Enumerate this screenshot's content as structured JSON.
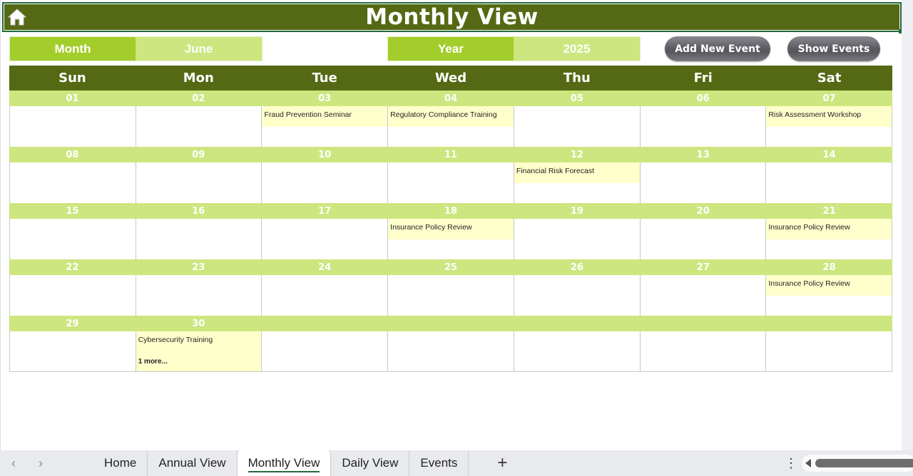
{
  "title": "Monthly View",
  "icons": {
    "home": "home-icon"
  },
  "selectors": {
    "month_label": "Month",
    "month_value": "June",
    "year_label": "Year",
    "year_value": "2025"
  },
  "buttons": {
    "add_event": "Add New Event",
    "show_events": "Show Events"
  },
  "colors": {
    "header_dark": "#556914",
    "label_green": "#a3cd2a",
    "light_green": "#cde67f",
    "event_yellow": "#ffffcc"
  },
  "weekdays": [
    "Sun",
    "Mon",
    "Tue",
    "Wed",
    "Thu",
    "Fri",
    "Sat"
  ],
  "weeks": [
    [
      {
        "d": "01"
      },
      {
        "d": "02"
      },
      {
        "d": "03",
        "event": "Fraud Prevention Seminar"
      },
      {
        "d": "04",
        "event": "Regulatory Compliance Training"
      },
      {
        "d": "05"
      },
      {
        "d": "06"
      },
      {
        "d": "07",
        "event": "Risk Assessment Workshop"
      }
    ],
    [
      {
        "d": "08"
      },
      {
        "d": "09"
      },
      {
        "d": "10"
      },
      {
        "d": "11"
      },
      {
        "d": "12",
        "event": "Financial Risk Forecast"
      },
      {
        "d": "13"
      },
      {
        "d": "14"
      }
    ],
    [
      {
        "d": "15"
      },
      {
        "d": "16"
      },
      {
        "d": "17"
      },
      {
        "d": "18",
        "event": "Insurance Policy Review"
      },
      {
        "d": "19"
      },
      {
        "d": "20"
      },
      {
        "d": "21",
        "event": "Insurance Policy Review"
      }
    ],
    [
      {
        "d": "22"
      },
      {
        "d": "23"
      },
      {
        "d": "24"
      },
      {
        "d": "25"
      },
      {
        "d": "26"
      },
      {
        "d": "27"
      },
      {
        "d": "28",
        "event": "Insurance Policy Review"
      }
    ],
    [
      {
        "d": "29"
      },
      {
        "d": "30",
        "event": "Cybersecurity Training",
        "more": "1 more..."
      },
      {
        "d": ""
      },
      {
        "d": ""
      },
      {
        "d": ""
      },
      {
        "d": ""
      },
      {
        "d": ""
      }
    ]
  ],
  "sheet_tabs": [
    "Home",
    "Annual View",
    "Monthly View",
    "Daily View",
    "Events"
  ],
  "active_tab": "Monthly View",
  "add_sheet": "+"
}
